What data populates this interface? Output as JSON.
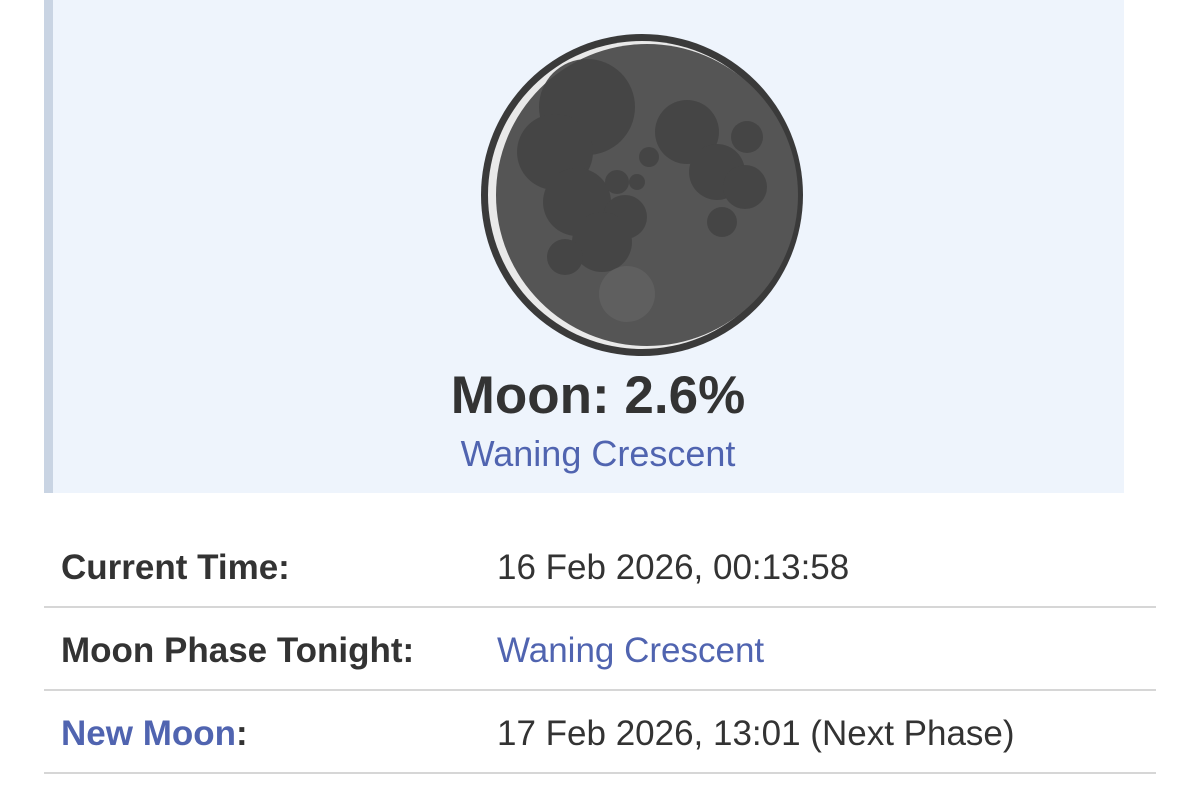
{
  "moon": {
    "illumination_label": "Moon: 2.6%",
    "illumination_percent": 2.6,
    "phase_name": "Waning Crescent",
    "icon": "moon-crescent-icon"
  },
  "details": {
    "current_time_label": "Current Time:",
    "current_time_value": "16 Feb 2026, 00:13:58",
    "phase_tonight_label": "Moon Phase Tonight:",
    "phase_tonight_value": "Waning Crescent",
    "new_moon_link": "New Moon",
    "new_moon_colon": ":",
    "new_moon_value": "17 Feb 2026, 13:01 (Next Phase)"
  },
  "colors": {
    "panel_background": "#eef4fc",
    "panel_border": "#c9d4e3",
    "link": "#5064b0",
    "text": "#333333",
    "moon_dark": "#4f4f4f",
    "moon_outline": "#3a3a3a"
  }
}
